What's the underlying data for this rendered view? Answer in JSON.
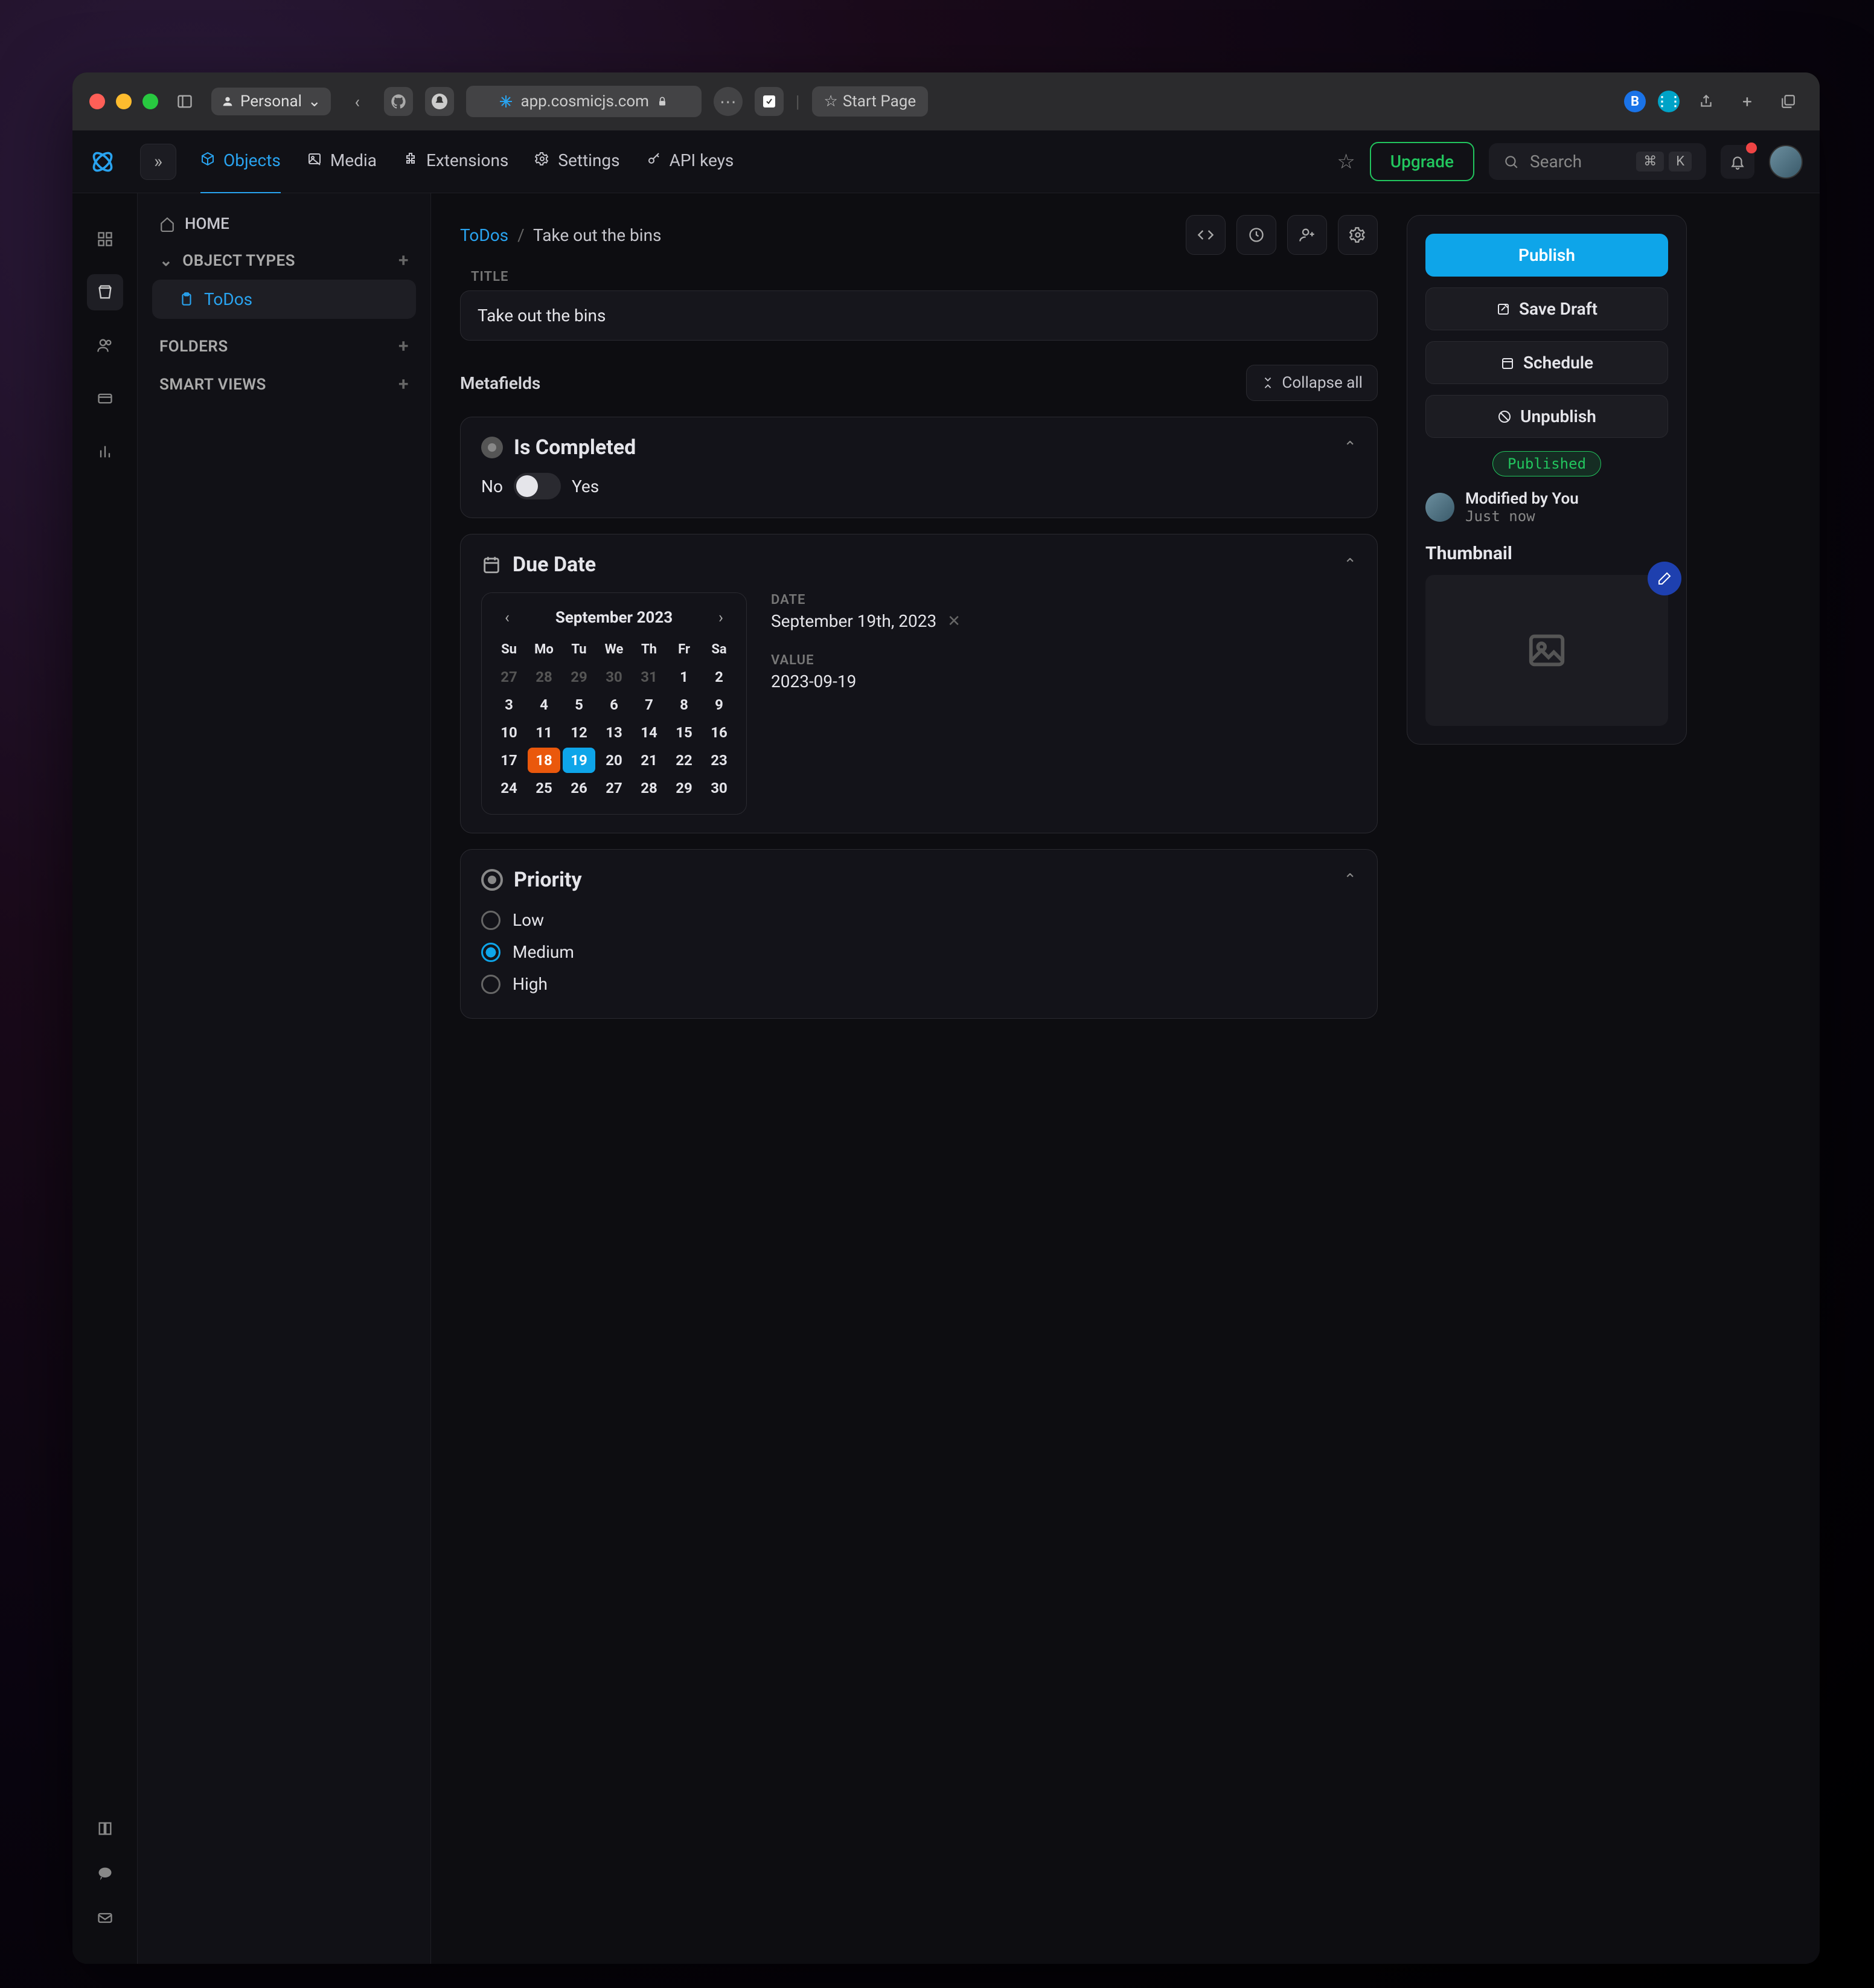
{
  "browser": {
    "profile": "Personal",
    "url": "app.cosmicjs.com",
    "start_page": "Start Page"
  },
  "topnav": {
    "tabs": [
      "Objects",
      "Media",
      "Extensions",
      "Settings",
      "API keys"
    ],
    "upgrade": "Upgrade",
    "search_placeholder": "Search",
    "shortcut": [
      "⌘",
      "K"
    ]
  },
  "sidebar": {
    "home": "HOME",
    "headers": {
      "object_types": "OBJECT TYPES",
      "folders": "FOLDERS",
      "smart_views": "SMART VIEWS"
    },
    "types": [
      {
        "label": "ToDos"
      }
    ]
  },
  "crumbs": {
    "root": "ToDos",
    "current": "Take out the bins"
  },
  "title": {
    "label": "TITLE",
    "value": "Take out the bins"
  },
  "metafields": {
    "heading": "Metafields",
    "collapse": "Collapse all",
    "is_completed": {
      "title": "Is Completed",
      "no": "No",
      "yes": "Yes",
      "value": false
    },
    "due_date": {
      "title": "Due Date",
      "month": "September 2023",
      "weekdays": [
        "Su",
        "Mo",
        "Tu",
        "We",
        "Th",
        "Fr",
        "Sa"
      ],
      "lead": [
        27,
        28,
        29,
        30,
        31
      ],
      "days": [
        1,
        2,
        3,
        4,
        5,
        6,
        7,
        8,
        9,
        10,
        11,
        12,
        13,
        14,
        15,
        16,
        17,
        18,
        19,
        20,
        21,
        22,
        23,
        24,
        25,
        26,
        27,
        28,
        29,
        30
      ],
      "today": 18,
      "selected": 19,
      "date_label": "DATE",
      "date_value": "September 19th, 2023",
      "value_label": "VALUE",
      "value": "2023-09-19"
    },
    "priority": {
      "title": "Priority",
      "options": [
        "Low",
        "Medium",
        "High"
      ],
      "selected": "Medium"
    }
  },
  "panel": {
    "publish": "Publish",
    "save_draft": "Save Draft",
    "schedule": "Schedule",
    "unpublish": "Unpublish",
    "status": "Published",
    "modified_by": "Modified by You",
    "modified_when": "Just now",
    "thumbnail": "Thumbnail"
  }
}
